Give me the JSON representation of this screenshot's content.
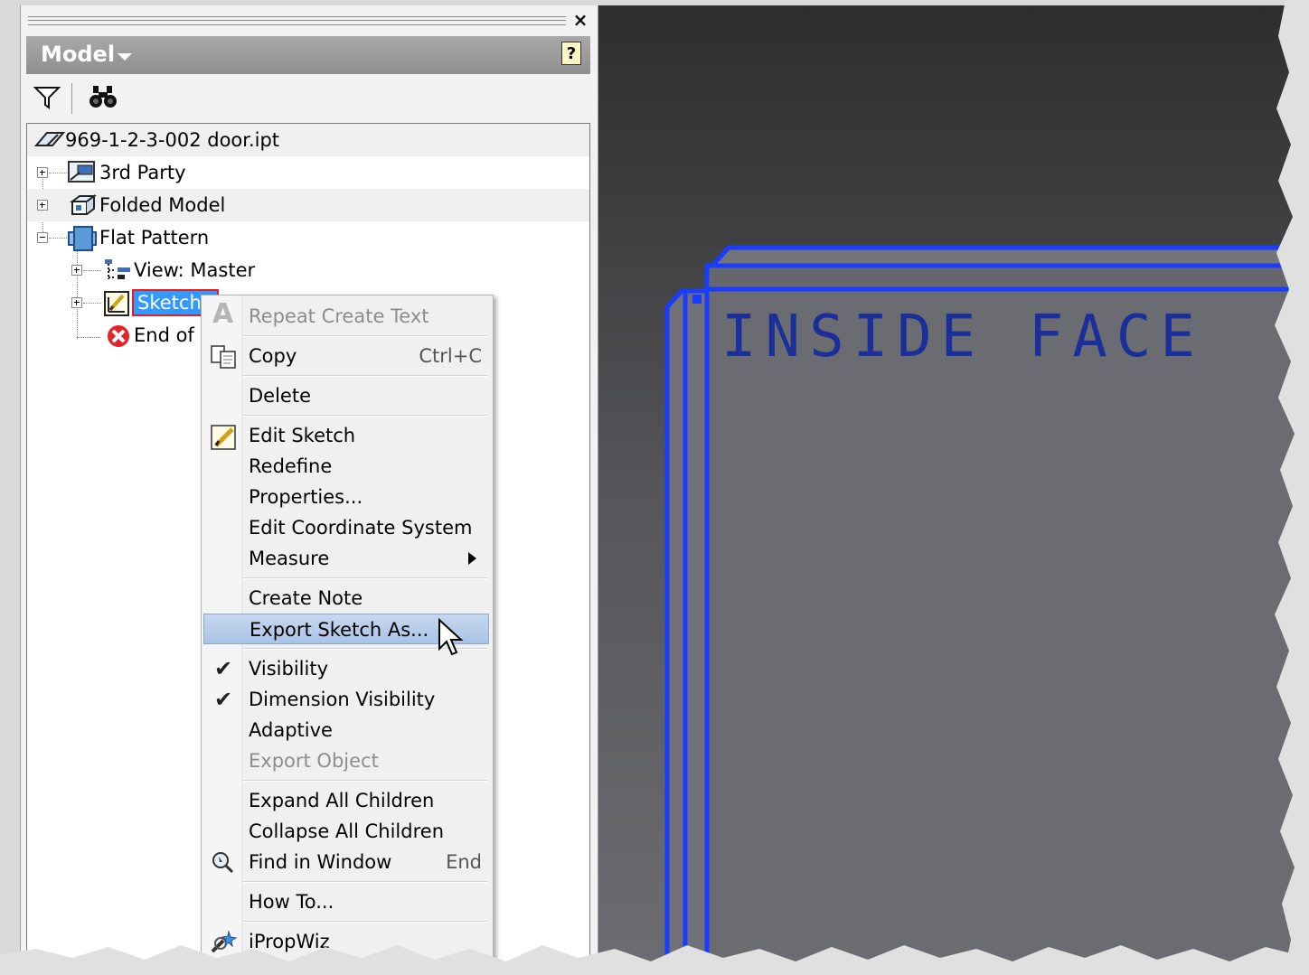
{
  "browser": {
    "title": "Model",
    "help_label": "?",
    "close_label": "×",
    "toolbar": {
      "filter_icon": "filter-icon",
      "find_icon": "binoculars-icon"
    },
    "tree": {
      "root": {
        "label": "969-1-2-3-002 door.ipt",
        "icon": "part-icon"
      },
      "items": [
        {
          "label": "3rd Party",
          "icon": "3rd-party-icon",
          "expander": "+"
        },
        {
          "label": "Folded Model",
          "icon": "folded-model-icon",
          "expander": "+"
        },
        {
          "label": "Flat Pattern",
          "icon": "flat-pattern-icon",
          "expander": "-"
        },
        {
          "label": "View: Master",
          "icon": "view-master-icon",
          "expander": "+"
        },
        {
          "label": "Sketch1",
          "icon": "sketch-icon",
          "expander": "+",
          "selected": true
        },
        {
          "label": "End of",
          "icon": "end-of-part-icon"
        }
      ]
    }
  },
  "viewport": {
    "sketch_text": "INSIDE FACE",
    "edge_color": "#1a3cff",
    "face_color": "#6b6c71"
  },
  "context_menu": {
    "items": [
      {
        "label": "Repeat Create Text",
        "disabled": true,
        "icon": "text-a-icon"
      },
      {
        "label": "Copy",
        "shortcut": "Ctrl+C",
        "icon": "copy-icon"
      },
      {
        "label": "Delete"
      },
      {
        "label": "Edit Sketch",
        "icon": "edit-sketch-icon"
      },
      {
        "label": "Redefine"
      },
      {
        "label": "Properties..."
      },
      {
        "label": "Edit Coordinate System"
      },
      {
        "label": "Measure",
        "submenu": true
      },
      {
        "label": "Create Note"
      },
      {
        "label": "Export Sketch As...",
        "highlighted": true
      },
      {
        "label": "Visibility",
        "checked": true
      },
      {
        "label": "Dimension Visibility",
        "checked": true
      },
      {
        "label": "Adaptive"
      },
      {
        "label": "Export Object",
        "disabled": true
      },
      {
        "label": "Expand All Children"
      },
      {
        "label": "Collapse All Children"
      },
      {
        "label": "Find in Window",
        "shortcut": "End",
        "icon": "find-in-window-icon"
      },
      {
        "label": "How To..."
      },
      {
        "label": "iPropWiz",
        "icon": "ipropwiz-icon"
      }
    ]
  }
}
